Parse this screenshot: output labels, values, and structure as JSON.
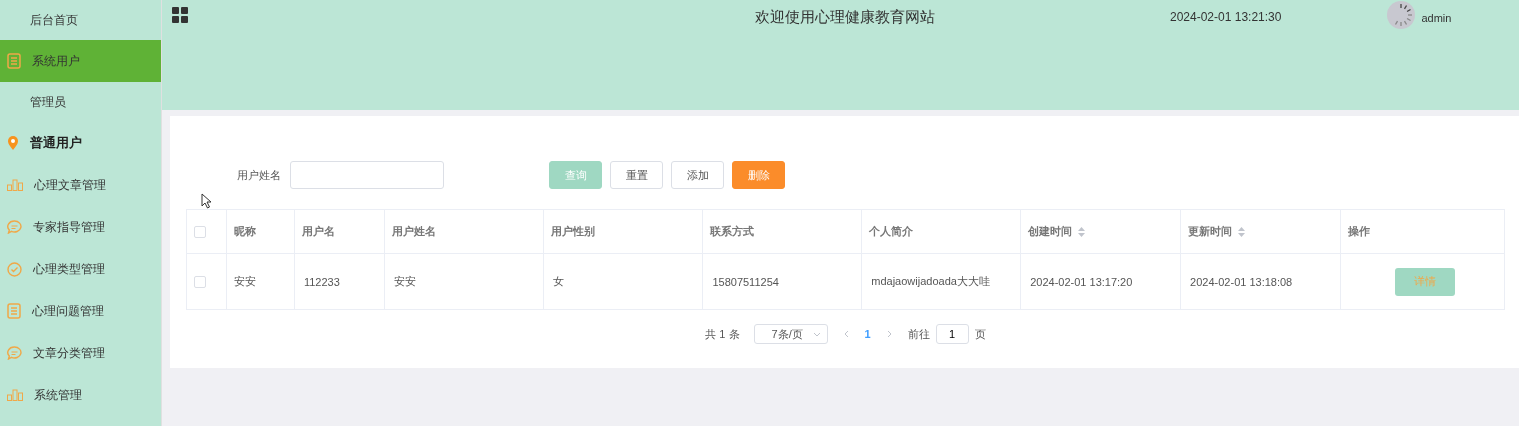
{
  "sidebar": {
    "items": [
      {
        "kind": "sub",
        "label": "后台首页",
        "selected": false,
        "highlighted": false
      },
      {
        "kind": "menu",
        "label": "系统用户",
        "selected": true,
        "highlighted": false
      },
      {
        "kind": "sub",
        "label": "管理员",
        "selected": false,
        "highlighted": false
      },
      {
        "kind": "menu",
        "label": "普通用户",
        "selected": false,
        "highlighted": true
      },
      {
        "kind": "menu",
        "label": "心理文章管理",
        "selected": false,
        "highlighted": false
      },
      {
        "kind": "menu",
        "label": "专家指导管理",
        "selected": false,
        "highlighted": false
      },
      {
        "kind": "menu",
        "label": "心理类型管理",
        "selected": false,
        "highlighted": false
      },
      {
        "kind": "menu",
        "label": "心理问题管理",
        "selected": false,
        "highlighted": false
      },
      {
        "kind": "menu",
        "label": "文章分类管理",
        "selected": false,
        "highlighted": false
      },
      {
        "kind": "menu",
        "label": "系统管理",
        "selected": false,
        "highlighted": false
      }
    ]
  },
  "header": {
    "title": "欢迎使用心理健康教育网站",
    "datetime": "2024-02-01 13:21:30",
    "user": "admin"
  },
  "search": {
    "label": "用户姓名",
    "buttons": [
      {
        "kind": "primary",
        "label": "查询"
      },
      {
        "kind": "default",
        "label": "重置"
      },
      {
        "kind": "default",
        "label": "添加"
      },
      {
        "kind": "danger",
        "label": "删除"
      }
    ]
  },
  "table": {
    "all_checked": false,
    "columns": [
      {
        "label": "昵称",
        "sortable": false
      },
      {
        "label": "用户名",
        "sortable": false
      },
      {
        "label": "用户姓名",
        "sortable": false
      },
      {
        "label": "用户性别",
        "sortable": false
      },
      {
        "label": "联系方式",
        "sortable": false
      },
      {
        "label": "个人简介",
        "sortable": false
      },
      {
        "label": "创建时间",
        "sortable": true
      },
      {
        "label": "更新时间",
        "sortable": true
      },
      {
        "label": "操作",
        "sortable": false
      }
    ],
    "rows": [
      {
        "selected": false,
        "cells": [
          "安安",
          "112233",
          "安安",
          "女",
          "15807511254",
          "mdajaowijadoada大大哇",
          "2024-02-01 13:17:20",
          "2024-02-01 13:18:08"
        ],
        "action": "详情"
      }
    ]
  },
  "pagination": {
    "total": "共 1 条",
    "page_size": "7条/页",
    "pages": [
      {
        "label": "1",
        "selected": true
      }
    ],
    "goto_label": "前往",
    "goto_value": "1",
    "page_suffix": "页"
  }
}
